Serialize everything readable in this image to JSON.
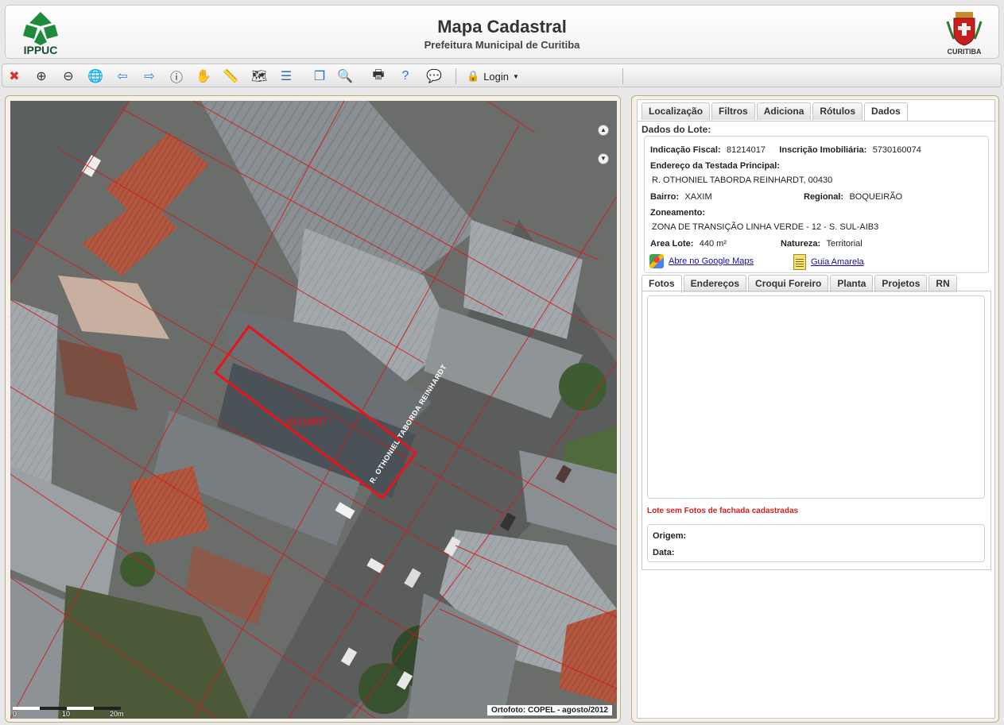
{
  "header": {
    "logo_left_text": "IPPUC",
    "title": "Mapa Cadastral",
    "subtitle": "Prefeitura Municipal de Curitiba",
    "logo_right_text": "CURITIBA"
  },
  "toolbar": {
    "tools": [
      {
        "name": "clear-icon",
        "glyph": "✖",
        "color": "#d6332f"
      },
      {
        "name": "zoom-in-icon",
        "glyph": "⊕",
        "color": "#333"
      },
      {
        "name": "zoom-out-icon",
        "glyph": "⊖",
        "color": "#333"
      },
      {
        "name": "zoom-extent-icon",
        "glyph": "🌐",
        "color": "#2b6fb7"
      },
      {
        "name": "back-arrow-icon",
        "glyph": "⇦",
        "color": "#3b7dd8"
      },
      {
        "name": "forward-arrow-icon",
        "glyph": "⇨",
        "color": "#3b7dd8"
      },
      {
        "name": "info-icon",
        "glyph": "ⓘ",
        "color": "#333"
      },
      {
        "name": "pan-hand-icon",
        "glyph": "✋",
        "color": "#c78e3a"
      },
      {
        "name": "measure-icon",
        "glyph": "📏",
        "color": "#333"
      },
      {
        "name": "map-icon",
        "glyph": "🗺",
        "color": "#333"
      },
      {
        "name": "legend-icon",
        "glyph": "☰",
        "color": "#2b6fb7"
      },
      {
        "name": "layers-icon",
        "glyph": "❐",
        "color": "#2b6fb7"
      },
      {
        "name": "search-map-icon",
        "glyph": "🔍",
        "color": "#2b6fb7"
      },
      {
        "name": "print-icon",
        "glyph": "🖶",
        "color": "#333"
      },
      {
        "name": "help-icon",
        "glyph": "?",
        "color": "#1f6fd1"
      },
      {
        "name": "chat-icon",
        "glyph": "💬",
        "color": "#2b6fb7"
      }
    ],
    "login_label": "Login"
  },
  "map": {
    "lot_label": "81214017",
    "street_label": "R. OTHONIEL TABORDA REINHARDT",
    "attribution": "Ortofoto: COPEL - agosto/2012",
    "scale_labels": [
      "0",
      "10",
      "20m"
    ]
  },
  "side": {
    "tabs": [
      {
        "label": "Localização",
        "active": false
      },
      {
        "label": "Filtros",
        "active": false
      },
      {
        "label": "Adiciona",
        "active": false
      },
      {
        "label": "Rótulos",
        "active": false
      },
      {
        "label": "Dados",
        "active": true
      }
    ],
    "dados_title": "Dados do Lote:",
    "indicacao_label": "Indicação Fiscal:",
    "indicacao_value": "81214017",
    "inscricao_label": "Inscrição Imobiliária:",
    "inscricao_value": "5730160074",
    "endereco_label": "Endereço da Testada Principal:",
    "endereco_value": "R. OTHONIEL TABORDA REINHARDT, 00430",
    "bairro_label": "Bairro:",
    "bairro_value": "XAXIM",
    "regional_label": "Regional:",
    "regional_value": "BOQUEIRÃO",
    "zoneamento_label": "Zoneamento:",
    "zoneamento_value": "ZONA DE TRANSIÇÃO LINHA VERDE - 12 - S. SUL-AIB3",
    "area_label": "Area Lote:",
    "area_value": "440 m²",
    "natureza_label": "Natureza:",
    "natureza_value": "Territorial",
    "google_maps_link": "Abre no Google Maps",
    "guia_link": "Guia Amarela",
    "sub_tabs": [
      {
        "label": "Fotos",
        "active": true
      },
      {
        "label": "Endereços",
        "active": false
      },
      {
        "label": "Croqui Foreiro",
        "active": false
      },
      {
        "label": "Planta",
        "active": false
      },
      {
        "label": "Projetos",
        "active": false
      },
      {
        "label": "RN",
        "active": false
      }
    ],
    "no_photos_msg": "Lote sem Fotos de fachada cadastradas",
    "origem_label": "Origem:",
    "data_label": "Data:"
  },
  "colors": {
    "lot_outline": "#e8141a",
    "parcel_lines": "#d31a1a",
    "error_text": "#d62020"
  }
}
